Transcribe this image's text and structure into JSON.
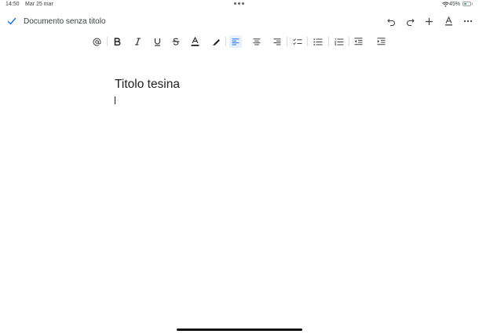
{
  "status_bar": {
    "time": "14:50",
    "date": "Mar 25 mar",
    "battery_text": "45%",
    "battery_level": 0.45
  },
  "title_bar": {
    "document_title": "Documento senza titolo"
  },
  "document": {
    "heading": "Titolo tesina"
  },
  "colors": {
    "accent": "#1a73e8",
    "active_button_bg": "#e8f0fe",
    "battery_fill": "#34a853"
  }
}
